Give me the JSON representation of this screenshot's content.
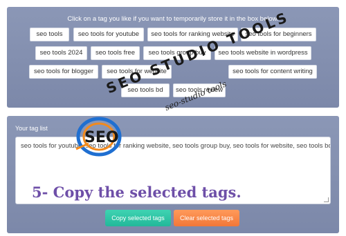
{
  "instruction": "Click on a tag you like if you want to temporarily store it in the box below.",
  "tags": [
    "seo tools",
    "seo tools for youtube",
    "seo tools for ranking website",
    "seo tools for beginners",
    "seo tools 2024",
    "seo tools free",
    "seo tools group buy",
    "seo tools website in wordpress",
    "seo tools for blogger",
    "seo tools for website",
    "seo tools for content writing",
    "seo tools bd",
    "seo tools review"
  ],
  "tag_list_label": "Your tag list",
  "tag_list_value": "seo tools for youtube, seo tools for ranking website, seo tools group buy, seo tools for website, seo tools bd",
  "buttons": {
    "copy": "Copy selected tags",
    "clear": "Clear selected tags"
  },
  "caption": "5- Copy the selected tags.",
  "watermark": {
    "main": "SEO STUDIO TOOLS",
    "script": "seo-studio tools"
  },
  "colors": {
    "panel": "#8b97b6",
    "copy_button": "#22b89a",
    "clear_button": "#f27738",
    "caption": "#6e4fa8"
  }
}
